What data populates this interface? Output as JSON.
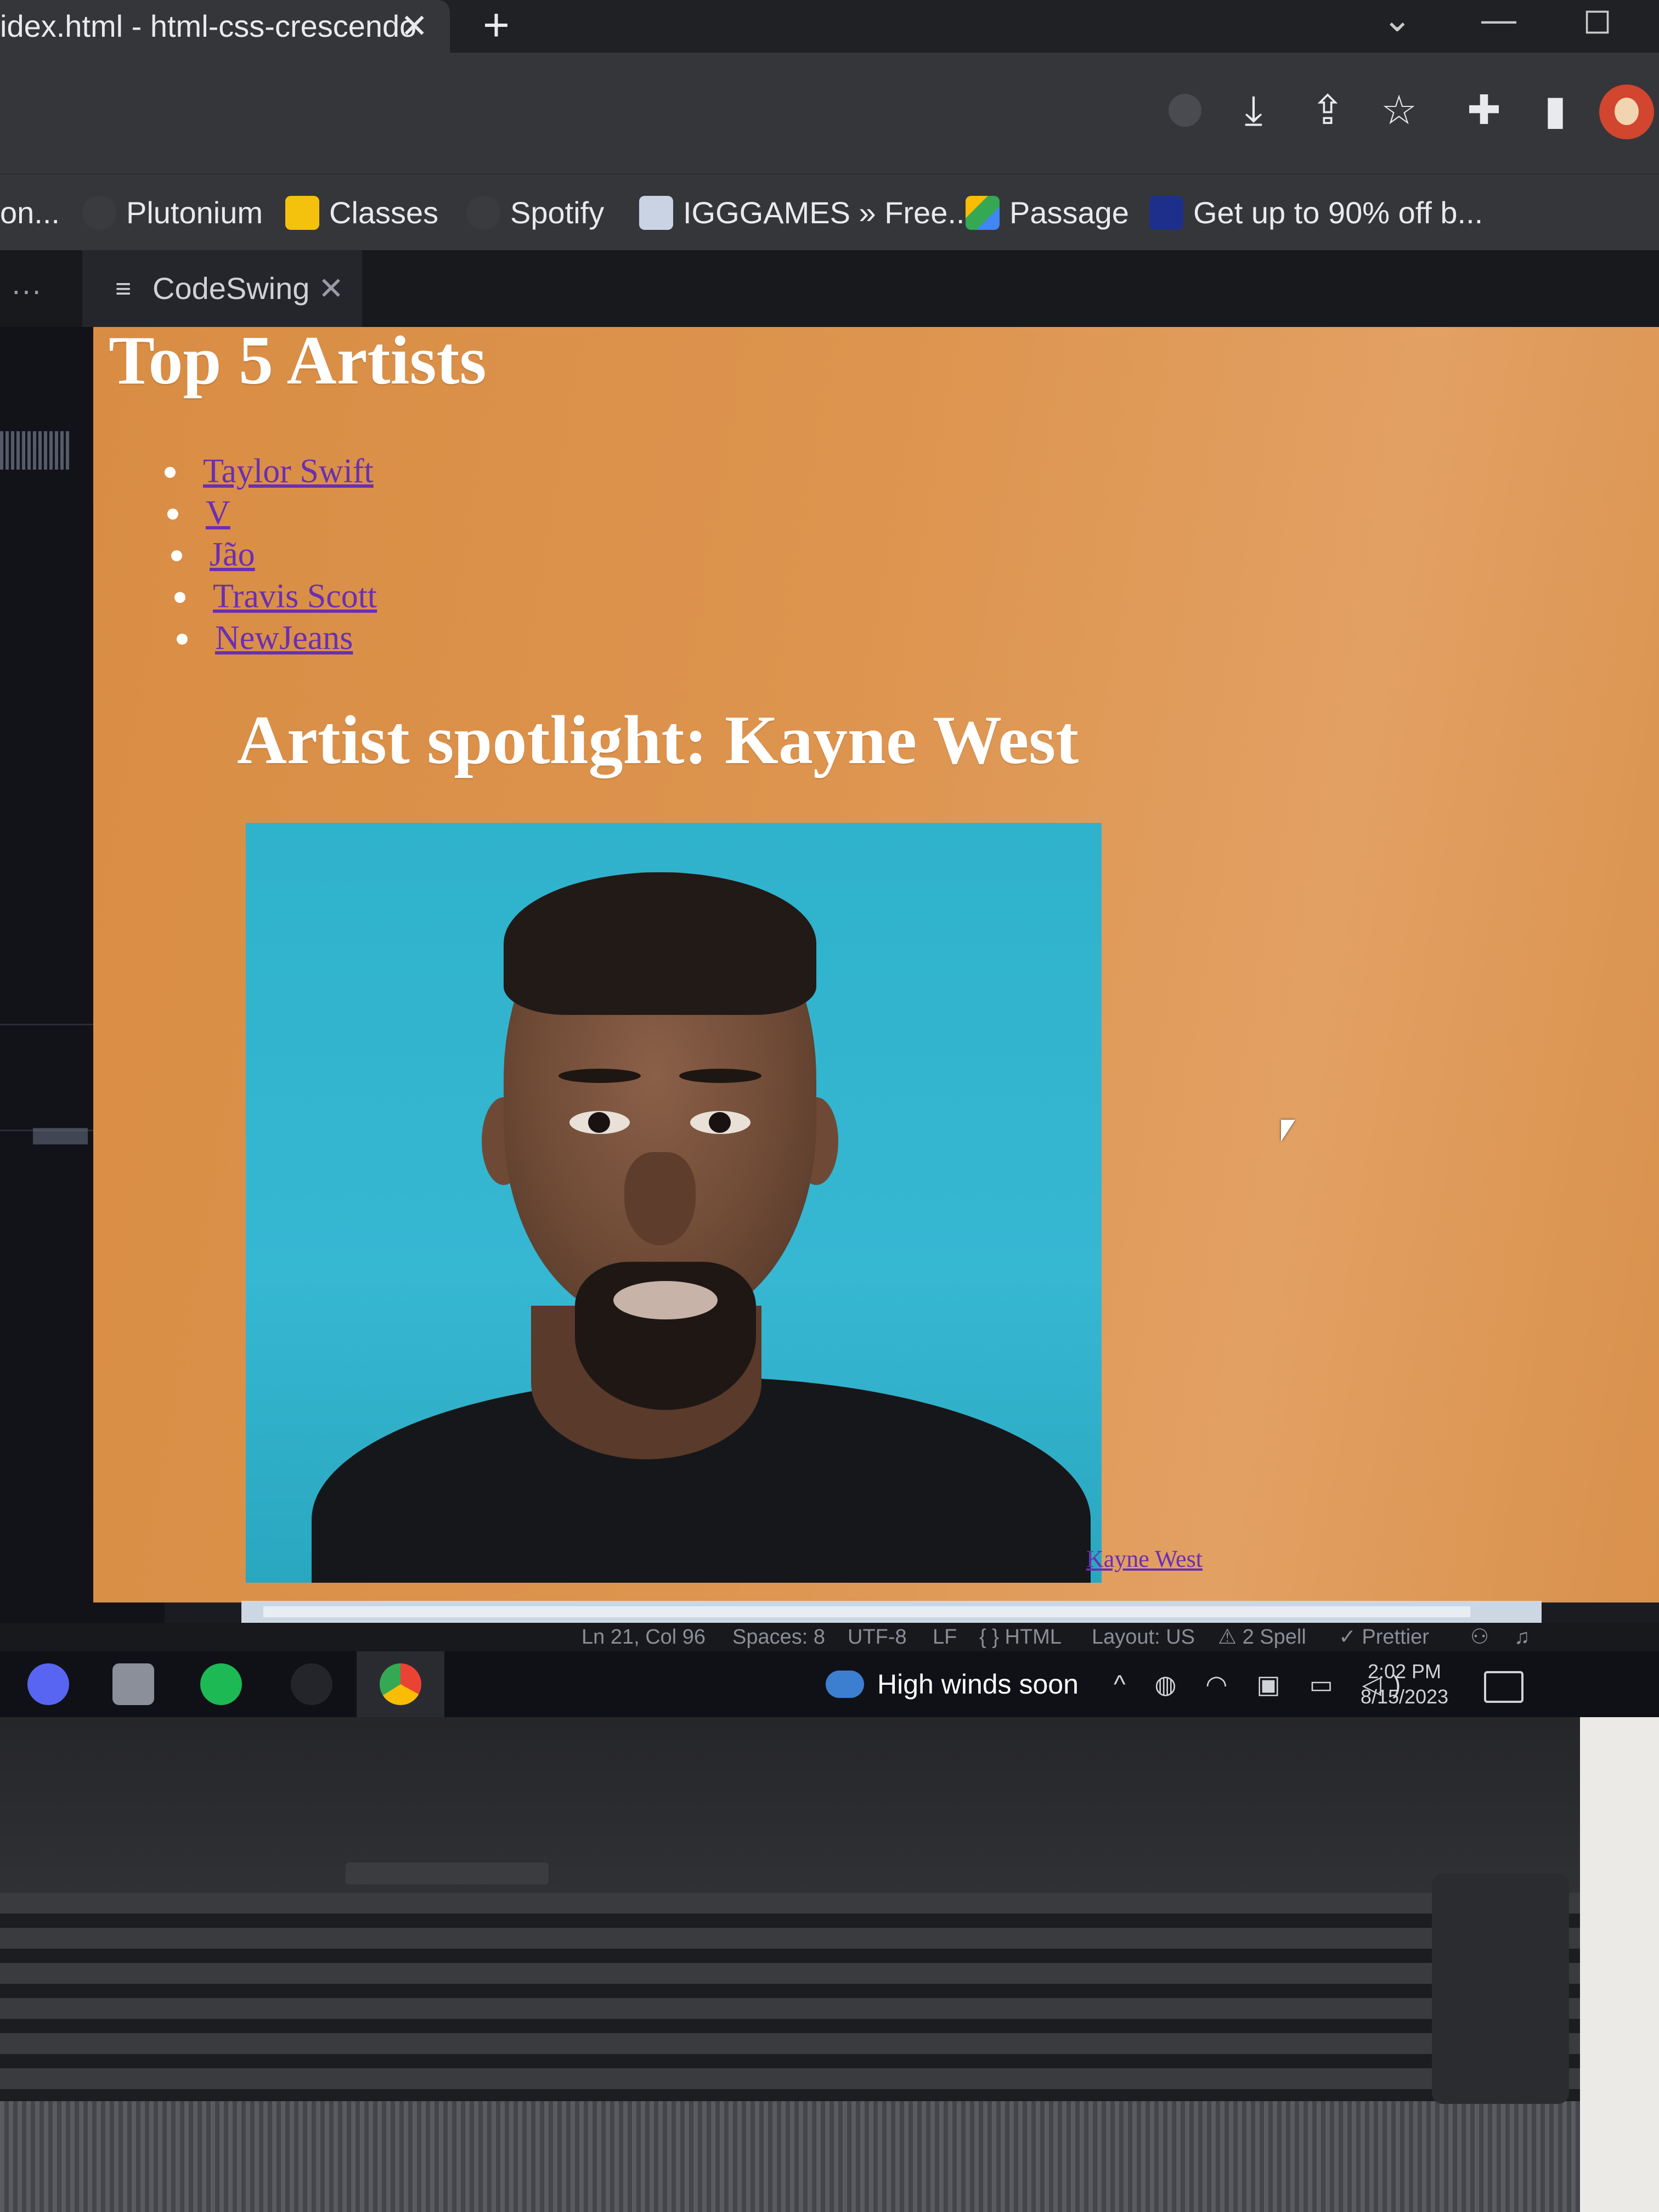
{
  "browser": {
    "tab_title": "idex.html - html-css-crescendo",
    "close_glyph": "✕",
    "new_tab_glyph": "+",
    "window_controls": [
      "⌄",
      "—",
      "◻"
    ],
    "toolbar_icons": [
      "download-icon",
      "share-icon",
      "star-icon",
      "extensions-icon",
      "sidebar-icon",
      "profile-avatar"
    ]
  },
  "bookmarks": [
    {
      "label": "on...",
      "color": "#35363a"
    },
    {
      "label": "Plutonium",
      "color": "#3a3b3f"
    },
    {
      "label": "Classes",
      "color": "#f4c20d"
    },
    {
      "label": "Spotify",
      "color": "#3a3b3f"
    },
    {
      "label": "IGGGAMES » Free...",
      "color": "#c9d3e3"
    },
    {
      "label": "Passage",
      "color": "#34a853"
    },
    {
      "label": "Get up to 90% off b...",
      "color": "#1d2f8a"
    }
  ],
  "editor": {
    "menu_dots": "···",
    "tab_label": "CodeSwing",
    "tab_close": "✕"
  },
  "page": {
    "title": "Top 5 Artists",
    "artists": [
      "Taylor Swift",
      "V",
      "Jão",
      "Travis Scott",
      "NewJeans"
    ],
    "spotlight": "Artist spotlight: Kayne West",
    "caption_link": "Kayne West",
    "background": "#dd944e",
    "link_color": "#6a2fb2"
  },
  "statusbar": {
    "position": "Ln 21, Col 96",
    "spaces": "Spaces: 8",
    "encoding": "UTF-8",
    "eol": "LF",
    "language": "{ } HTML",
    "layout": "Layout: US",
    "spell": "⚠ 2 Spell",
    "prettier": "✓ Prettier"
  },
  "taskbar": {
    "weather": "High winds soon",
    "time": "2:02 PM",
    "date": "8/15/2023",
    "tray": "^ ◍ ◠ ▣ ▭ ◁)"
  }
}
